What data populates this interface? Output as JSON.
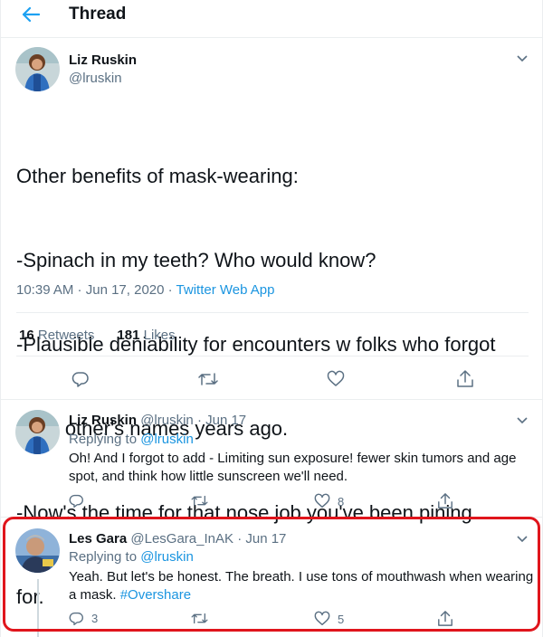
{
  "header": {
    "title": "Thread"
  },
  "main_tweet": {
    "name": "Liz Ruskin",
    "handle": "@lruskin",
    "text_lines": [
      "Other benefits of mask-wearing:",
      "-Spinach in my teeth? Who would know?",
      "-Plausible deniability for encounters w folks who forgot",
      "each other's names years ago.",
      "-Now's the time for that nose job you've been pining",
      "for."
    ],
    "time": "10:39 AM",
    "date": "Jun 17, 2020",
    "client": "Twitter Web App",
    "separator": " · ",
    "retweets_count": "16",
    "retweets_label": "Retweets",
    "likes_count": "181",
    "likes_label": "Likes"
  },
  "reply1": {
    "name": "Liz Ruskin",
    "handle": "@lruskin",
    "date": "· Jun 17",
    "replying_label": "Replying to",
    "replying_handle": "@lruskin",
    "text_line1": "Oh! And I forgot to add - Limiting sun exposure! fewer skin tumors and age",
    "text_line2": "spot, and think how little sunscreen we'll need.",
    "likes": "8"
  },
  "reply2": {
    "name": "Les Gara",
    "handle": "@LesGara_InAK",
    "date": "· Jun 17",
    "replying_label": "Replying to",
    "replying_handle": "@lruskin",
    "text_line1": "Yeah. But let's be honest. The breath. I use tons of mouthwash when wearing",
    "text_line2_plain": "a mask.",
    "text_line2_hashtag": "#Overshare",
    "replies": "3",
    "likes": "5"
  },
  "colors": {
    "accent": "#1da1f2",
    "link": "#1b95e0",
    "secondary_text": "#5b7083",
    "highlight_border": "#e0151c"
  },
  "icons": [
    "back-arrow-icon",
    "chevron-down-icon",
    "reply-icon",
    "retweet-icon",
    "like-icon",
    "share-icon"
  ]
}
